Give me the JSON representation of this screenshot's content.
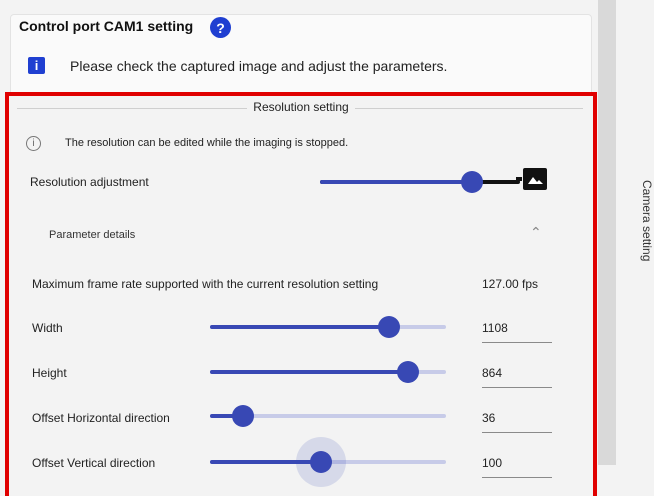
{
  "header": {
    "title": "Control port CAM1 setting",
    "help_icon": "question-circle-icon",
    "info_icon": "info-icon",
    "message": "Please check the captured image and adjust the parameters."
  },
  "resolution_section": {
    "title": "Resolution setting",
    "note": "The resolution can be edited while the imaging is stopped.",
    "adjustment_label": "Resolution adjustment",
    "adjustment_level": 0.76,
    "image_icon": "image-icon"
  },
  "details": {
    "label": "Parameter details",
    "expanded": true
  },
  "max_frame_rate": {
    "label": "Maximum frame rate supported with the current resolution setting",
    "value": "127.00 fps"
  },
  "params": [
    {
      "label": "Width",
      "value": "1108",
      "level": 0.76
    },
    {
      "label": "Height",
      "value": "864",
      "level": 0.84
    },
    {
      "label": "Offset Horizontal direction",
      "value": "36",
      "level": 0.14
    },
    {
      "label": "Offset Vertical direction",
      "value": "100",
      "level": 0.47
    }
  ],
  "side_panel": {
    "label": "Camera setting"
  },
  "colors": {
    "accent": "#3848b4",
    "highlight_border": "#e00000",
    "icon_blue": "#1f3fd1"
  }
}
